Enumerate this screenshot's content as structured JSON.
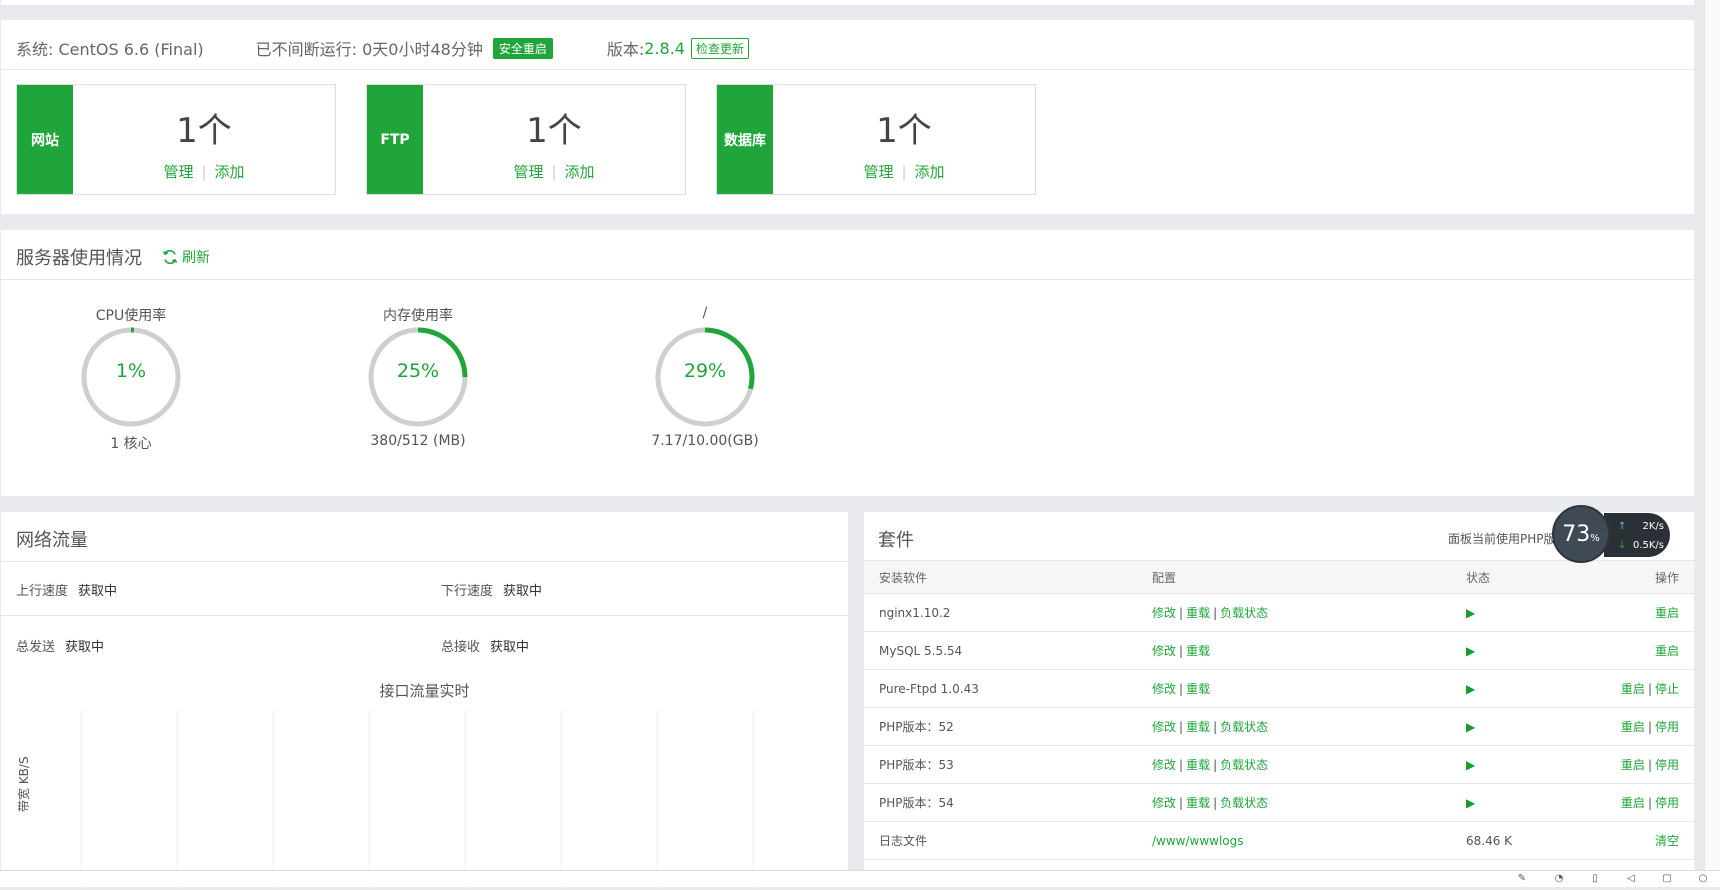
{
  "system": {
    "os_label": "系统: CentOS 6.6 (Final)",
    "uptime_label": "已不间断运行: 0天0小时48分钟",
    "safe_restart": "安全重启",
    "version_prefix": "版本: ",
    "version": "2.8.4",
    "check_update": "检查更新"
  },
  "cards": [
    {
      "tag": "网站",
      "count": "1个",
      "manage": "管理",
      "add": "添加",
      "sep": "|"
    },
    {
      "tag": "FTP",
      "count": "1个",
      "manage": "管理",
      "add": "添加",
      "sep": "|"
    },
    {
      "tag": "数据库",
      "count": "1个",
      "manage": "管理",
      "add": "添加",
      "sep": "|"
    }
  ],
  "usage": {
    "title": "服务器使用情况",
    "refresh": "刷新",
    "gauges": [
      {
        "title": "CPU使用率",
        "percent_text": "1%",
        "percent": 1,
        "sub": "1 核心"
      },
      {
        "title": "内存使用率",
        "percent_text": "25%",
        "percent": 25,
        "sub": "380/512 (MB)"
      },
      {
        "title": "/",
        "percent_text": "29%",
        "percent": 29,
        "sub": "7.17/10.00(GB)"
      }
    ]
  },
  "network": {
    "title": "网络流量",
    "up_label": "上行速度",
    "up_value": "获取中",
    "down_label": "下行速度",
    "down_value": "获取中",
    "sent_label": "总发送",
    "sent_value": "获取中",
    "recv_label": "总接收",
    "recv_value": "获取中",
    "chart_title": "接口流量实时",
    "y_axis": "带宽 KB/S"
  },
  "software": {
    "title": "套件",
    "note": "面板当前使用PHP版本",
    "headers": [
      "安装软件",
      "配置",
      "状态",
      "操作"
    ],
    "rows": [
      {
        "name": "nginx1.10.2",
        "config": [
          "修改",
          "重载",
          "负载状态"
        ],
        "ops": [
          "重启"
        ]
      },
      {
        "name": "MySQL 5.5.54",
        "config": [
          "修改",
          "重载"
        ],
        "ops": [
          "重启"
        ]
      },
      {
        "name": "Pure-Ftpd 1.0.43",
        "config": [
          "修改",
          "重载"
        ],
        "ops": [
          "重启",
          "停止"
        ]
      },
      {
        "name": "PHP版本：52",
        "config": [
          "修改",
          "重载",
          "负载状态"
        ],
        "ops": [
          "重启",
          "停用"
        ]
      },
      {
        "name": "PHP版本：53",
        "config": [
          "修改",
          "重载",
          "负载状态"
        ],
        "ops": [
          "重启",
          "停用"
        ]
      },
      {
        "name": "PHP版本：54",
        "config": [
          "修改",
          "重载",
          "负载状态"
        ],
        "ops": [
          "重启",
          "停用"
        ]
      }
    ],
    "log_row": {
      "name": "日志文件",
      "path": "/www/wwwlogs",
      "size": "68.46 K",
      "op": "清空"
    }
  },
  "speed_widget": {
    "percent": "73",
    "percent_unit": "%",
    "up": "2",
    "down": "0.5",
    "unit": "K/s"
  },
  "colors": {
    "accent": "#20a53a",
    "background": "#e9eaee"
  }
}
